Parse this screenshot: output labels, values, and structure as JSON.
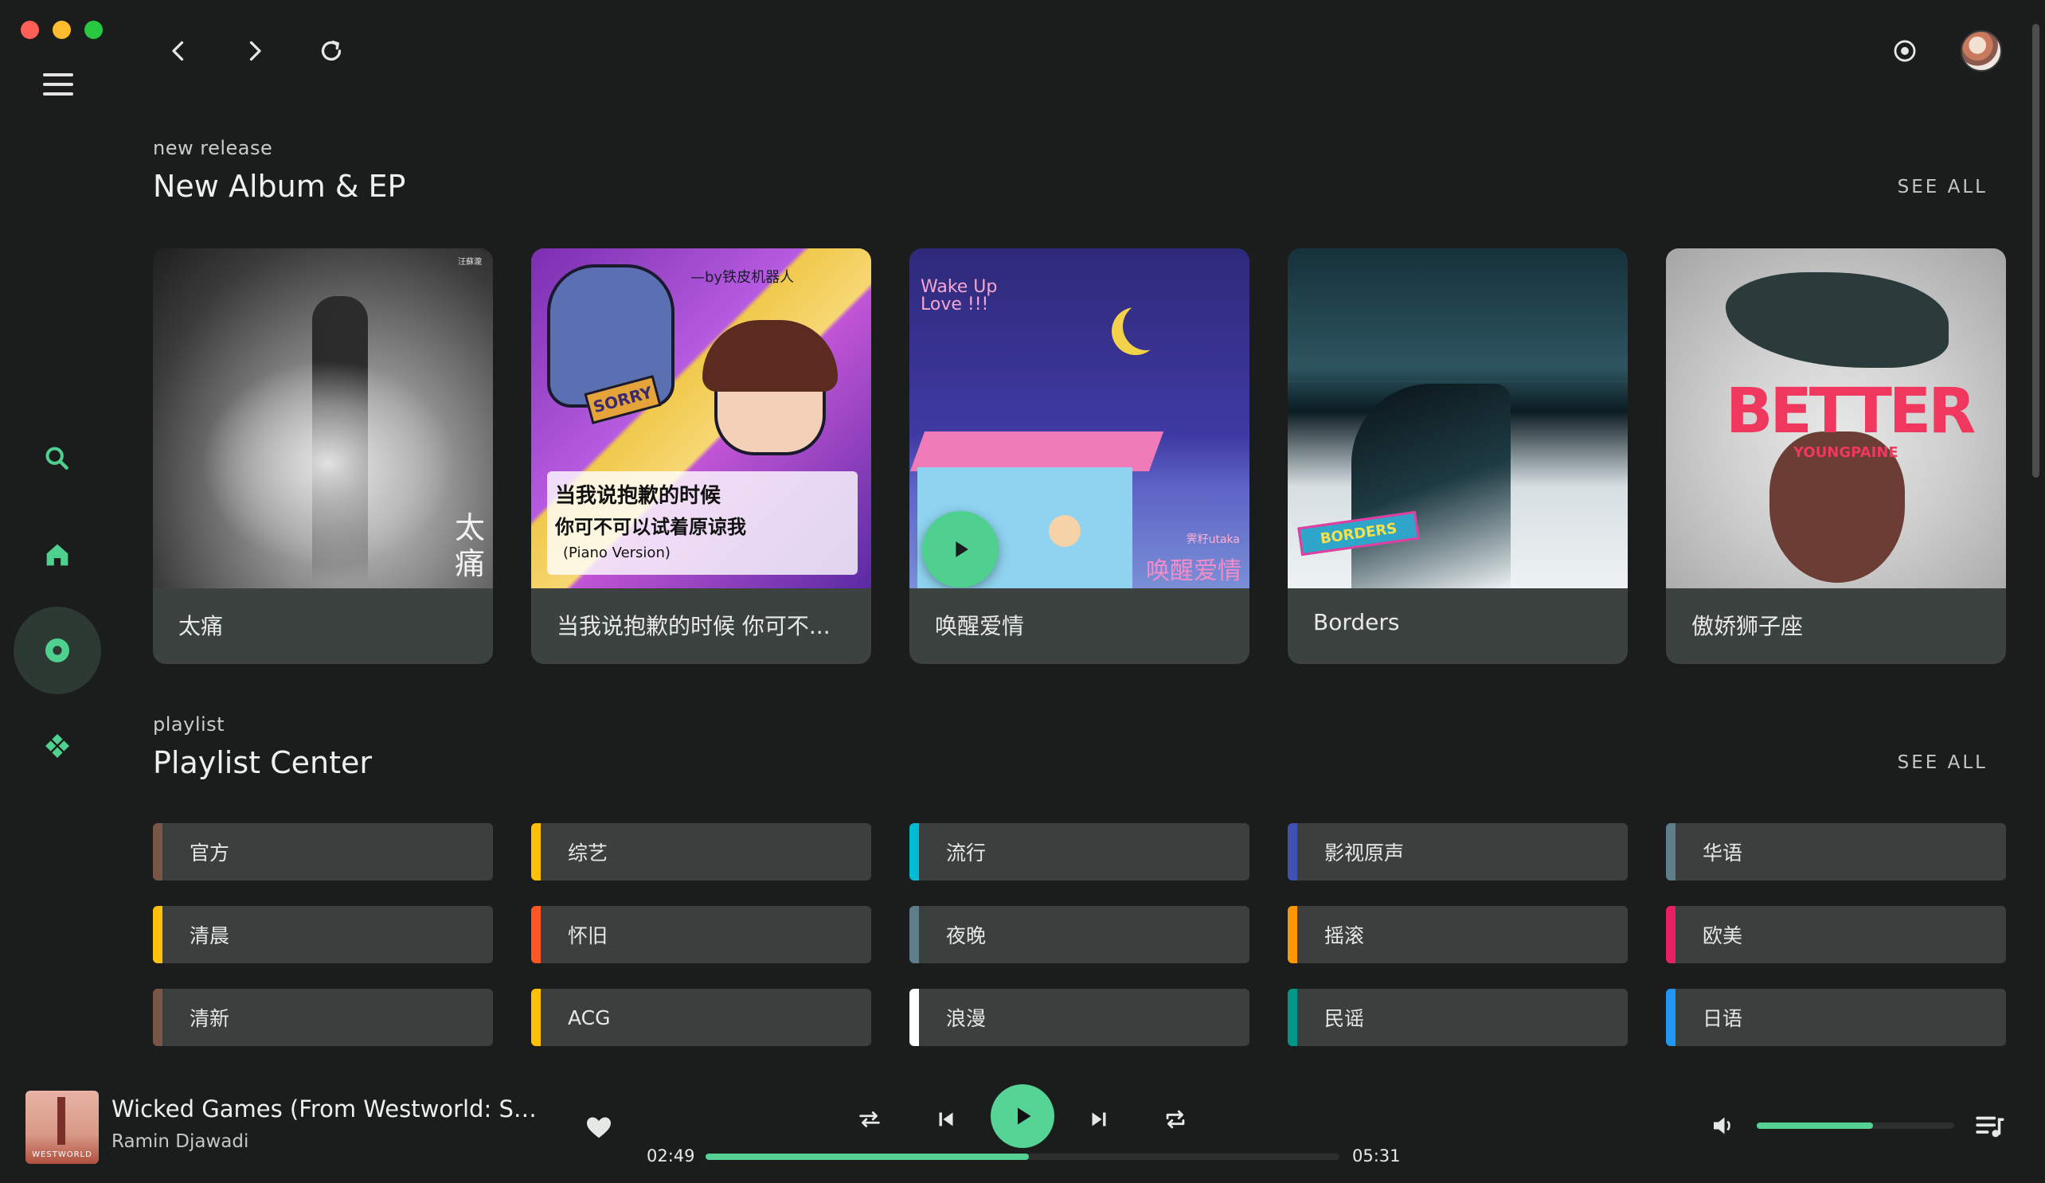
{
  "sections": {
    "albums": {
      "kicker": "new release",
      "title": "New Album & EP",
      "see_all": "SEE ALL"
    },
    "playlists": {
      "kicker": "playlist",
      "title": "Playlist Center",
      "see_all": "SEE ALL"
    }
  },
  "albums": [
    {
      "name": "太痛",
      "cover_text_1": "太",
      "cover_text_2": "痛",
      "cover_small": "汪蘇瀧"
    },
    {
      "name": "当我说抱歉的时候 你可不...",
      "cover_text_1": "当我说抱歉的时候",
      "cover_text_2": "你可不可以试着原谅我",
      "cover_text_3": "(Piano Version)",
      "cover_small": "—by铁皮机器人",
      "badge": "SORRY"
    },
    {
      "name": "唤醒爱情",
      "cover_text_1": "Wake Up Love !!!",
      "cover_text_2": "唤醒爱情",
      "cover_small": "霁籽utaka"
    },
    {
      "name": "Borders",
      "cover_text_1": "BORDERS"
    },
    {
      "name": "傲娇狮子座",
      "cover_text_1": "BETTER",
      "cover_text_2": "YOUNGPAINE"
    }
  ],
  "playlists": [
    {
      "label": "官方",
      "color": "#795548"
    },
    {
      "label": "综艺",
      "color": "#ffc107"
    },
    {
      "label": "流行",
      "color": "#00bcd4"
    },
    {
      "label": "影视原声",
      "color": "#3f51b5"
    },
    {
      "label": "华语",
      "color": "#607d8b"
    },
    {
      "label": "清晨",
      "color": "#ffc107"
    },
    {
      "label": "怀旧",
      "color": "#ff5722"
    },
    {
      "label": "夜晚",
      "color": "#607d8b"
    },
    {
      "label": "摇滚",
      "color": "#ff9800"
    },
    {
      "label": "欧美",
      "color": "#e91e63"
    },
    {
      "label": "清新",
      "color": "#795548"
    },
    {
      "label": "ACG",
      "color": "#ffc107"
    },
    {
      "label": "浪漫",
      "color": "#ffffff"
    },
    {
      "label": "民谣",
      "color": "#009688"
    },
    {
      "label": "日语",
      "color": "#2196f3"
    }
  ],
  "player": {
    "title": "Wicked Games (From Westworld: Seaso...",
    "artist": "Ramin Djawadi",
    "cover_text": "WESTWORLD",
    "elapsed": "02:49",
    "duration": "05:31",
    "progress_fraction": 0.51,
    "volume_fraction": 0.59
  },
  "icons": {
    "nav": [
      "menu-icon",
      "back-icon",
      "forward-icon",
      "refresh-icon",
      "radio-icon"
    ],
    "rail": [
      "search-icon",
      "home-icon",
      "disc-icon",
      "discover-icon"
    ],
    "player": [
      "heart-icon",
      "shuffle-icon",
      "previous-icon",
      "play-icon",
      "next-icon",
      "repeat-icon",
      "volume-icon",
      "queue-icon"
    ]
  },
  "colors": {
    "accent": "#54d193",
    "background": "#1b1d1c",
    "card": "#3c4240"
  }
}
